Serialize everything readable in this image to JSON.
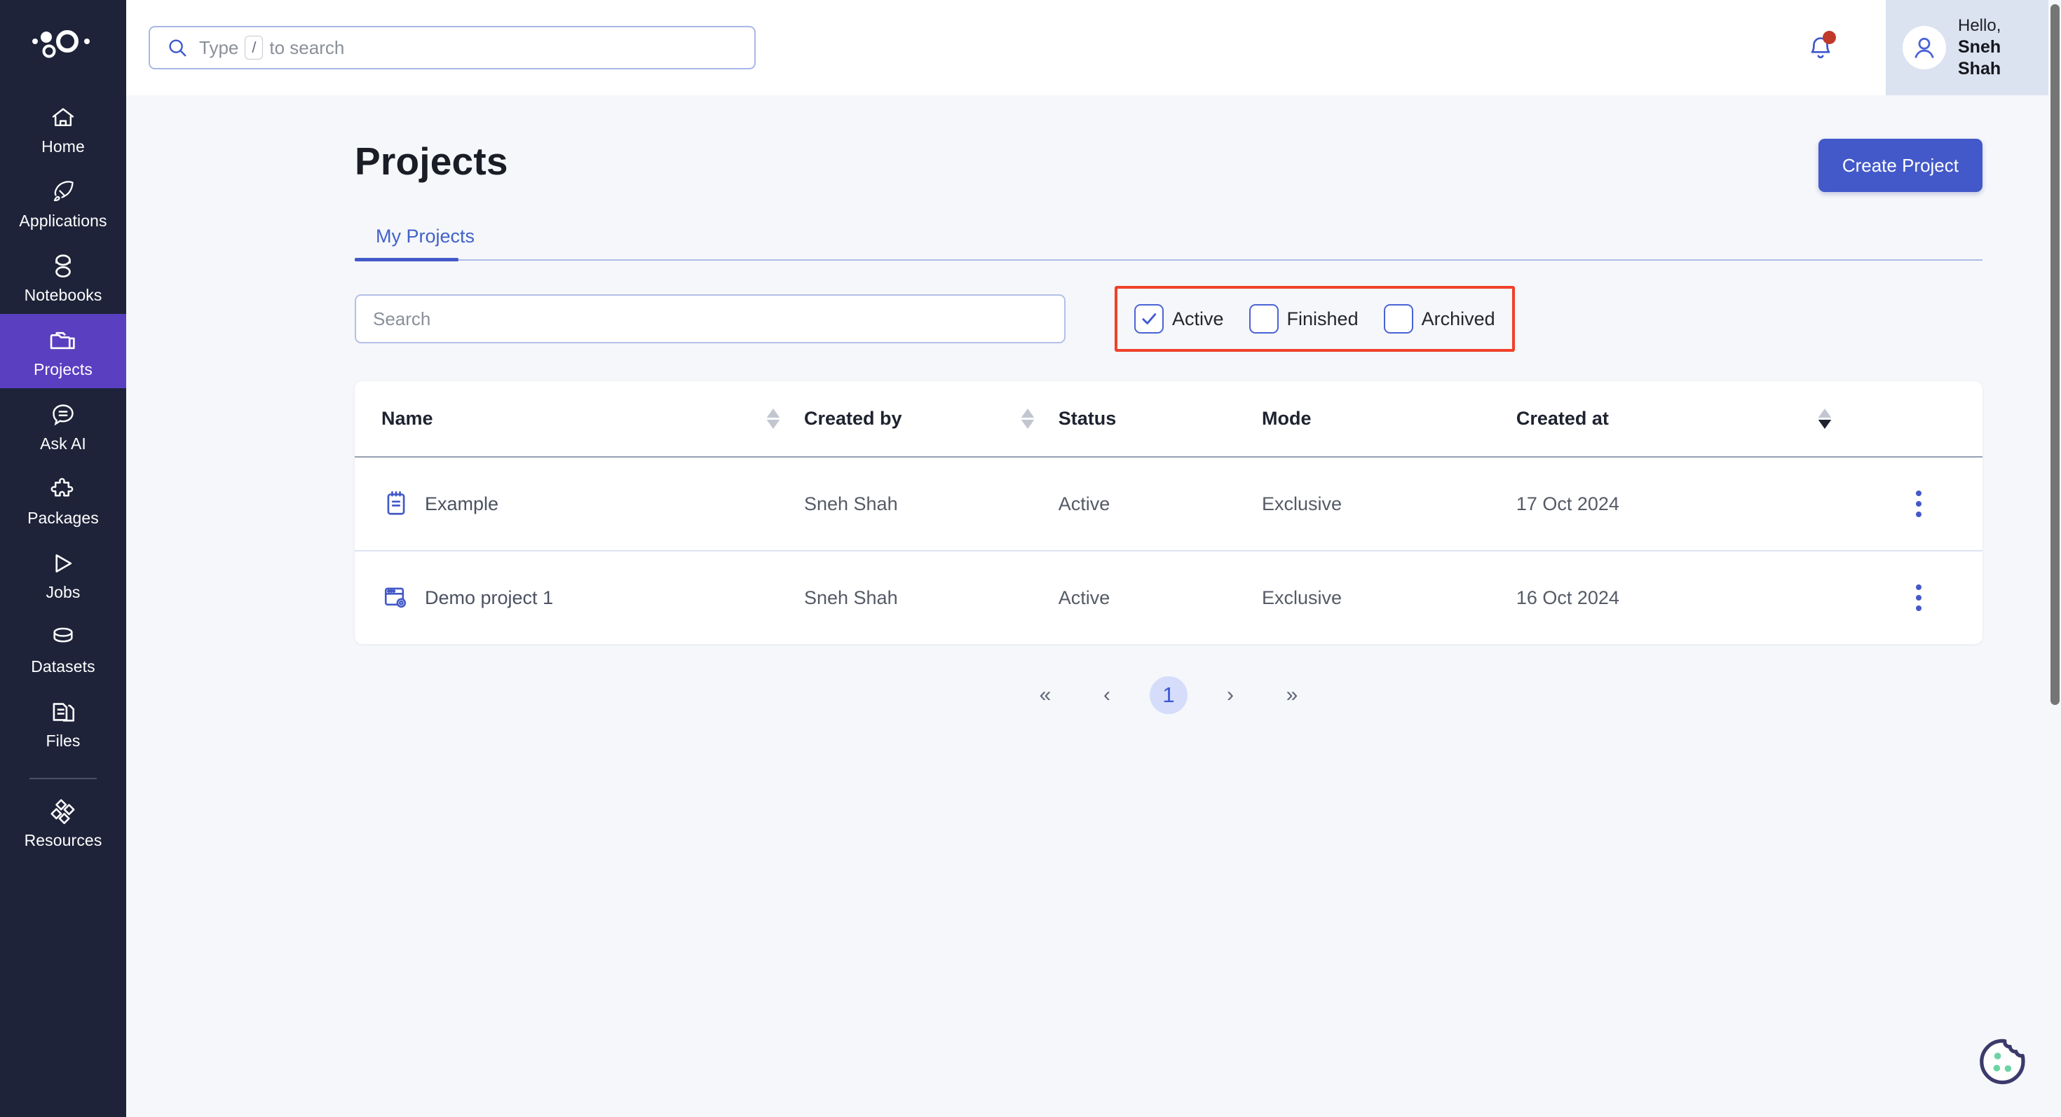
{
  "brand": {
    "logo_icon": "domino-dots-logo"
  },
  "sidebar": {
    "items": [
      {
        "label": "Home",
        "icon": "home-icon",
        "active": false
      },
      {
        "label": "Applications",
        "icon": "rocket-icon",
        "active": false
      },
      {
        "label": "Notebooks",
        "icon": "notebooks-icon",
        "active": false
      },
      {
        "label": "Projects",
        "icon": "folder-icon",
        "active": true
      },
      {
        "label": "Ask AI",
        "icon": "chat-bubble-icon",
        "active": false
      },
      {
        "label": "Packages",
        "icon": "puzzle-icon",
        "active": false
      },
      {
        "label": "Jobs",
        "icon": "play-triangle-icon",
        "active": false
      },
      {
        "label": "Datasets",
        "icon": "database-icon",
        "active": false
      },
      {
        "label": "Files",
        "icon": "files-icon",
        "active": false
      },
      {
        "label": "Resources",
        "icon": "diamonds-icon",
        "active": false
      }
    ]
  },
  "topbar": {
    "search": {
      "icon": "search-icon",
      "placeholder_prefix": "Type",
      "key_hint": "/",
      "placeholder_suffix": "to search",
      "value": ""
    },
    "notifications": {
      "icon": "bell-icon",
      "has_unread": true,
      "dot_color": "#c0392b"
    },
    "user": {
      "greeting": "Hello,",
      "name": "Sneh Shah",
      "avatar_icon": "user-avatar-icon"
    }
  },
  "page": {
    "title": "Projects",
    "create_button": "Create Project",
    "tabs": [
      {
        "label": "My Projects",
        "active": true
      }
    ]
  },
  "filters": {
    "search": {
      "placeholder": "Search",
      "value": ""
    },
    "checkboxes": [
      {
        "label": "Active",
        "checked": true
      },
      {
        "label": "Finished",
        "checked": false
      },
      {
        "label": "Archived",
        "checked": false
      }
    ],
    "highlight_color": "#f0412a"
  },
  "table": {
    "columns": [
      {
        "label": "Name",
        "sortable": true,
        "sort_state": "none"
      },
      {
        "label": "Created by",
        "sortable": true,
        "sort_state": "none"
      },
      {
        "label": "Status",
        "sortable": false,
        "sort_state": "none"
      },
      {
        "label": "Mode",
        "sortable": false,
        "sort_state": "none"
      },
      {
        "label": "Created at",
        "sortable": true,
        "sort_state": "desc"
      }
    ],
    "rows": [
      {
        "icon": "notebook-icon",
        "name": "Example",
        "created_by": "Sneh Shah",
        "status": "Active",
        "mode": "Exclusive",
        "created_at": "17 Oct 2024",
        "menu_icon": "kebab-menu-icon"
      },
      {
        "icon": "app-window-gear-icon",
        "name": "Demo project 1",
        "created_by": "Sneh Shah",
        "status": "Active",
        "mode": "Exclusive",
        "created_at": "16 Oct 2024",
        "menu_icon": "kebab-menu-icon"
      }
    ]
  },
  "pagination": {
    "first": "«",
    "prev": "‹",
    "current_page": "1",
    "next": "›",
    "last": "»"
  },
  "cookie_widget": {
    "icon": "cookie-icon",
    "body_color": "#3c3a6b",
    "chip_color": "#6ed3a4"
  },
  "colors": {
    "sidebar_bg": "#1e2339",
    "sidebar_active": "#5a3fc0",
    "accent_blue": "#4359c9",
    "page_bg": "#f5f7fa",
    "header_bg": "#ffffff",
    "user_chip_bg": "#dbe2f0"
  }
}
